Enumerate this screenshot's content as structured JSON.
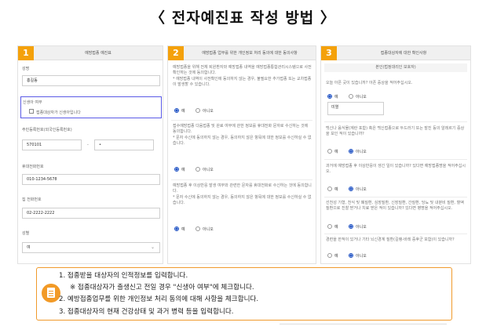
{
  "page": {
    "title": "〈 전자예진표 작성 방법 〉"
  },
  "panel1": {
    "number": "1",
    "title": "예방접종 예진표",
    "name_label": "성명",
    "name_value": "홍길동",
    "newborn_label": "신생아 여부",
    "newborn_checkbox": "접종대상자가 신생아입니다",
    "rrn_label": "주민등록번호(외국인등록번호)",
    "rrn_front": "570101",
    "rrn_dash": "-",
    "rrn_back": "•",
    "mobile_label": "휴대전화번호",
    "mobile_value": "010-1234-5678",
    "home_label": "집 전화번호",
    "home_value": "02-2222-2222",
    "gender_label": "성별",
    "gender_value": "여"
  },
  "panel2": {
    "number": "2",
    "title": "예방접종 업무를 위한 개인정보 처리 동의에 대한 동의사항",
    "q1": "예방접종을 위해 전체 퇴원환자와 예방접종 내역을 예방접종통합관리시스템으로 사전 확인하는 것에 동의합니다.",
    "q1_note": "* 예방접종 내역이 사전확인에 동의하지 않는 경우, 불필요한 추가접종 또는 교차접종이 발생할 수 있습니다.",
    "q2": "접수예방접종 다음접종 및 완료 여부에 관한 정보를 휴대전화 문자로 수신하는 것에 동의합니다.",
    "q2_note": "* 문자 수신에 동의하지 않는 경우, 동의하지 않은 항목에 대한 정보를 수신하실 수 없습니다.",
    "q3": "예방접종 후 이상반응 발생 여부와 관련한 문자를 휴대전화로 수신하는 것에 동의합니다.",
    "q3_note": "* 문자 수신에 동의하지 않는 경우, 동의하지 않은 항목에 대한 정보를 수신하실 수 없습니다.",
    "yes": "예",
    "no": "아니오"
  },
  "panel3": {
    "number": "3",
    "title": "접종대상자에 대한 확인사항",
    "subtitle": "본인(법정대리인 보호자)",
    "q1": "오늘 아픈 곳이 있습니까? 아픈 증상을 적어주십시오.",
    "q1_answer": "미열",
    "q2": "백신나 음식물(계란 포함) 혹은 백신접종으로 두드러기 또는 발진 등의 알레르기 증상을 보인 적이 있습니까?",
    "q3": "과거에 예방접종 후 이상반응이 생긴 일이 있습니까? 있다면 예방접종명을 적어주십시오.",
    "q4": "선천성 기형, 천식 및 폐질환, 심장질환, 신장질환, 간질환, 당뇨 및 내분비 질환, 혈액질환으로 진찰 받거나 치료 받은 적이 있습니까? 있다면 병명을 적어주십시오.",
    "q5": "경련을 한적이 있거나 기타 뇌신경계 질환(길랭-바레 증후군 포함)이 있습니까?",
    "yes": "예",
    "no": "아니오"
  },
  "guide": {
    "line1": "1. 접종받을 대상자의 인적정보를 입력합니다.",
    "line2": "※ 접종대상자가 출생신고 전일 경우 \"신생아 여부\"에 체크합니다.",
    "line3": "2. 예방접종업무를 위한 개인정보 처리 동의에 대해 사항을 체크합니다.",
    "line4": "3. 접종대상자의 현재 건강상태 및 과거 병력 등을 입력합니다."
  }
}
